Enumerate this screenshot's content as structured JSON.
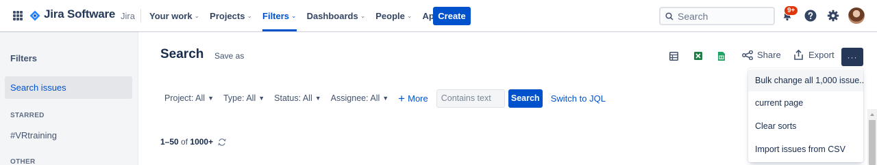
{
  "brand": {
    "name": "Jira Software",
    "sub": "Jira",
    "accent": "#0052cc",
    "logo_icon": "jira-diamond-icon"
  },
  "nav": {
    "items": [
      {
        "label": "Your work",
        "active": false
      },
      {
        "label": "Projects",
        "active": false
      },
      {
        "label": "Filters",
        "active": true
      },
      {
        "label": "Dashboards",
        "active": false
      },
      {
        "label": "People",
        "active": false
      },
      {
        "label": "Apps",
        "active": false
      }
    ],
    "create_label": "Create",
    "search_placeholder": "Search",
    "notification_badge": "9+",
    "icons": [
      "app-switcher-icon",
      "bell-icon",
      "help-icon",
      "gear-icon",
      "avatar"
    ]
  },
  "sidebar": {
    "title": "Filters",
    "active_item": "Search issues",
    "starred_heading": "STARRED",
    "starred_items": [
      "#VRtraining"
    ],
    "other_heading": "OTHER"
  },
  "main": {
    "title": "Search",
    "save_as": "Save as",
    "toolbar": {
      "share_label": "Share",
      "export_label": "Export",
      "more_label": "···"
    },
    "filters": {
      "project": "Project: All",
      "type": "Type: All",
      "status": "Status: All",
      "assignee": "Assignee: All",
      "more": "More",
      "text_placeholder": "Contains text",
      "search_button": "Search",
      "jql_link": "Switch to JQL"
    },
    "results": {
      "range": "1–50",
      "of": "of",
      "total": "1000+"
    }
  },
  "dropdown": {
    "items": [
      "Bulk change all 1,000 issue...",
      "current page",
      "Clear sorts",
      "Import issues from CSV"
    ]
  }
}
